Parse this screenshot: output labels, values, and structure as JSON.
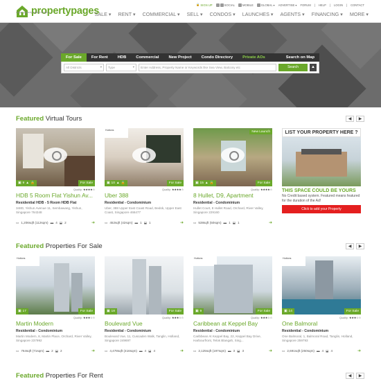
{
  "header": {
    "logo_text": "propertypages",
    "logo_tagline": "online property search engine",
    "util": [
      "SIGN UP",
      "SOCIAL",
      "MOBILE",
      "GLOBAL",
      "ADVERTISE",
      "FORUM",
      "HELP",
      "LOGIN",
      "CONTACT"
    ],
    "nav": [
      "SALE",
      "RENT",
      "COMMERCIAL",
      "SELL",
      "CONDOS",
      "LAUNCHES",
      "AGENTS",
      "FINANCING",
      "MORE"
    ]
  },
  "search": {
    "tabs": [
      "For Sale",
      "For Rent",
      "HDB",
      "Commercial",
      "New Project",
      "Condo Directory",
      "Private AOs",
      "Search on Map"
    ],
    "district": "All Districts",
    "type": "Type",
    "placeholder": "Enter Address, Property Name or Keywords like Sea View, Balcony etc",
    "button": "Search"
  },
  "virtual_tours": {
    "title_a": "Featured",
    "title_b": " Virtual Tours",
    "cards": [
      {
        "title": "HDB 5 Room Flat Yishun Av...",
        "sub": "Residential HDB - 5 Room HDB Flat",
        "addr": "348D, Yishun Avenue 11, Sembawang, Yishun, Singapore 764348",
        "size": "1,206sqft (112sqm)",
        "beds": "4",
        "baths": "2",
        "count": "9",
        "badge": "For Sale"
      },
      {
        "title": "Uber 388",
        "sub": "Residential - Condominium",
        "addr": "Uber, 388 Upper East Coast Road, Bedok, Upper East Coast, Singapore 466477",
        "size": "452sqft (42sqm)",
        "beds": "1",
        "baths": "1",
        "count": "10",
        "badge": "For Sale"
      },
      {
        "title": "8 Hullet, D9, Apartment",
        "sub": "Residential - Condominium",
        "addr": "Hullet Court, 8 Hullet Road, Orchard, River Valley, Singapore 229160",
        "size": "538sqft (50sqm)",
        "beds": "1",
        "baths": "1",
        "count": "15",
        "badge": "For Sale",
        "launch": "New Launch"
      }
    ],
    "ad": {
      "title": "LIST YOUR PROPERTY HERE ?",
      "head": "THIS SPACE COULD BE YOURS",
      "body": "No Credit based system. Featured means featured for the duration of the Ad!",
      "button": "Click to add your Property"
    }
  },
  "featured_sale": {
    "title_a": "Featured",
    "title_b": " Properties For Sale",
    "cards": [
      {
        "title": "Martin Modern",
        "sub": "Residential - Condominium",
        "addr": "Martin Modern, 8, Martin Place, Orchard, River Valley, Singapore 237992",
        "size": "764sqft (71sqm)",
        "beds": "2",
        "baths": "2",
        "count": "17",
        "badge": "For Sale"
      },
      {
        "title": "Boulevard Vue",
        "sub": "Residential - Condominium",
        "addr": "Boulevard Vue, 11, Cuscaden Walk, Tanglin, Holland, Singapore 249697",
        "size": "4,478sqft (416sqm)",
        "beds": "4",
        "baths": "4",
        "count": "18",
        "badge": "For Sale"
      },
      {
        "title": "Caribbean at Keppel Bay",
        "sub": "Residential - Condominium",
        "addr": "Caribbean At Keppel Bay, 22, Keppel Bay Drive, Harbourfront, Telok Blangah, Sing...",
        "size": "2,125sqft (197sqm)",
        "beds": "3",
        "baths": "3",
        "count": "9",
        "badge": "For Sale"
      },
      {
        "title": "One Balmoral",
        "sub": "Residential - Condominium",
        "addr": "One Balmoral, 1, Balmoral Road, Tanglin, Holland, Singapore 259793",
        "size": "2,691sqft (250sqm)",
        "beds": "4",
        "baths": "4",
        "count": "14",
        "badge": "For Sale"
      }
    ]
  },
  "featured_rent": {
    "title_a": "Featured",
    "title_b": " Properties For Rent"
  },
  "quality_label": "Quality:",
  "colors": {
    "accent": "#6aa82a",
    "dark": "#333333",
    "red": "#e41f1f"
  }
}
